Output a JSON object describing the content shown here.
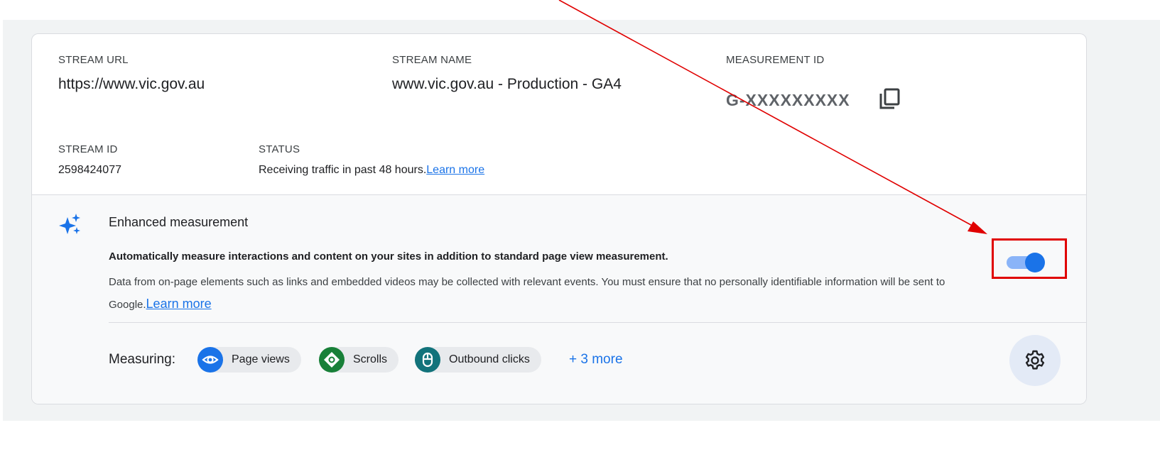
{
  "stream": {
    "url_label": "STREAM URL",
    "url_value": "https://www.vic.gov.au",
    "name_label": "STREAM NAME",
    "name_value": "www.vic.gov.au - Production - GA4",
    "mid_label": "MEASUREMENT ID",
    "mid_value": "G-XXXXXXXXX",
    "id_label": "STREAM ID",
    "id_value": "2598424077",
    "status_label": "STATUS",
    "status_value": "Receiving traffic in past 48 hours.",
    "status_link": "Learn more"
  },
  "enhanced": {
    "title": "Enhanced measurement",
    "bold_text": "Automatically measure interactions and content on your sites in addition to standard page view measurement.",
    "desc": "Data from on-page elements such as links and embedded videos may be collected with relevant events. You must ensure that no personally identifiable information will be sent to Google.",
    "learn_more": "Learn more",
    "toggle_on": true,
    "measuring_label": "Measuring:",
    "chips": [
      {
        "label": "Page views",
        "icon": "eye-icon",
        "color": "#1a73e8"
      },
      {
        "label": "Scrolls",
        "icon": "scroll-icon",
        "color": "#188038"
      },
      {
        "label": "Outbound clicks",
        "icon": "mouse-icon",
        "color": "#12737b"
      }
    ],
    "more": "+ 3 more"
  },
  "colors": {
    "accent": "#1a73e8",
    "highlight": "#e00000"
  }
}
